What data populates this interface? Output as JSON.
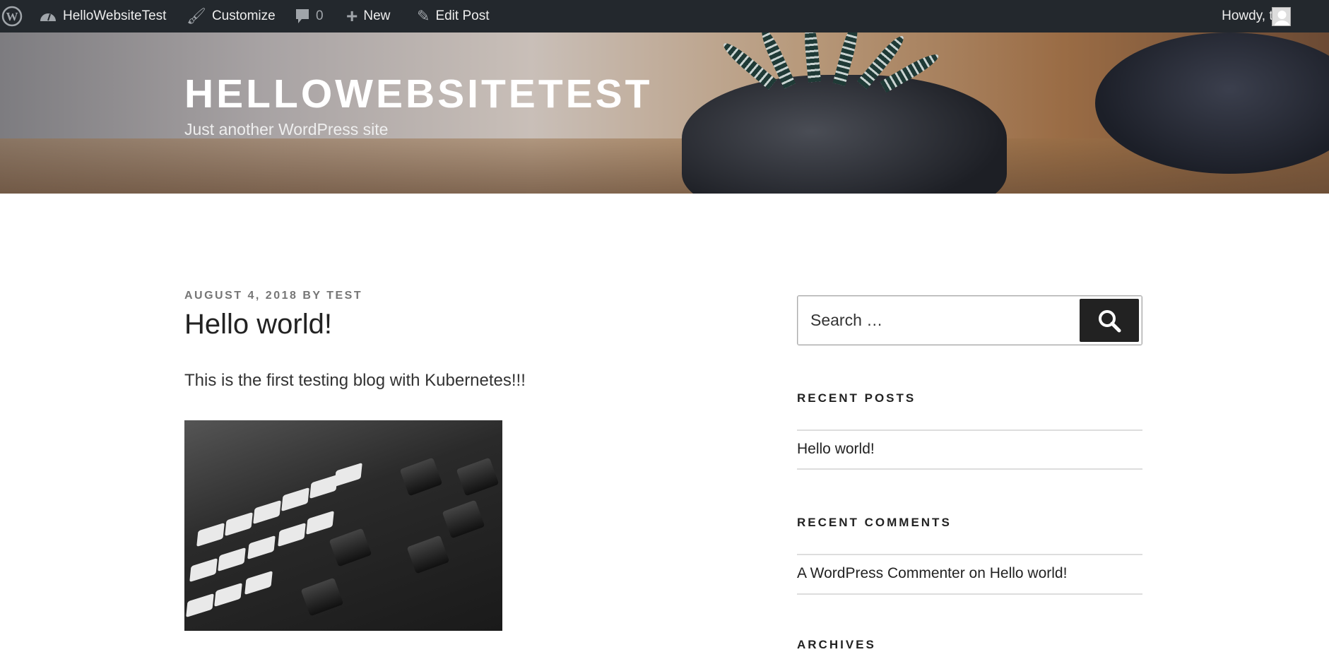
{
  "adminbar": {
    "site_name": "HelloWebsiteTest",
    "customize": "Customize",
    "comments_count": "0",
    "new": "New",
    "edit_post": "Edit Post",
    "howdy": "Howdy, test"
  },
  "header": {
    "title": "HELLOWEBSITETEST",
    "tagline": "Just another WordPress site"
  },
  "post": {
    "meta_date": "AUGUST 4, 2018",
    "meta_by": "BY",
    "meta_author": "TEST",
    "title": "Hello world!",
    "body": "This is the first testing blog with Kubernetes!!!"
  },
  "sidebar": {
    "search_placeholder": "Search …",
    "recent_posts_title": "RECENT POSTS",
    "recent_posts": [
      "Hello world!"
    ],
    "recent_comments_title": "RECENT COMMENTS",
    "recent_comment": {
      "author": "A WordPress Commenter",
      "on": "on",
      "post": "Hello world!"
    },
    "archives_title": "ARCHIVES"
  }
}
